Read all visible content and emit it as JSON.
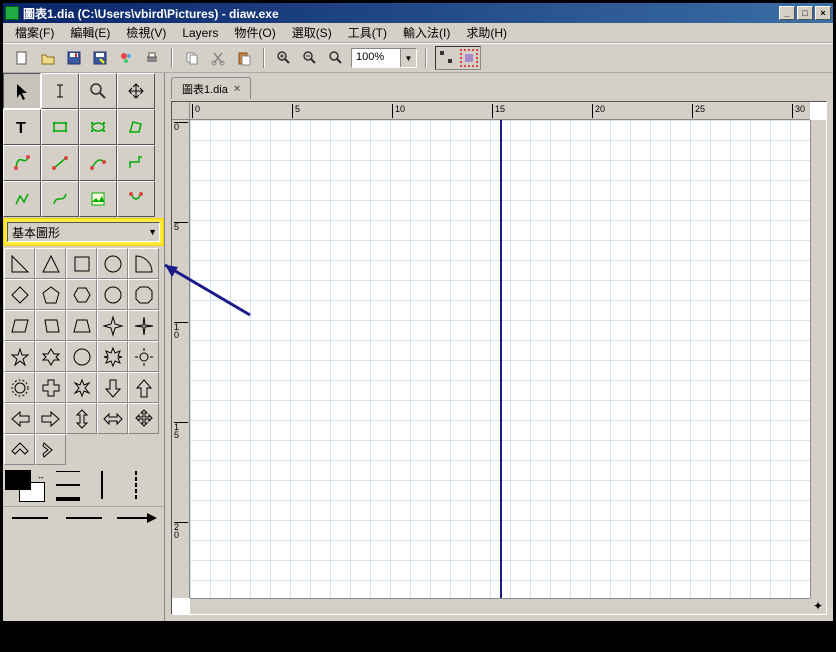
{
  "window": {
    "title": "圖表1.dia (C:\\Users\\vbird\\Pictures) - diaw.exe",
    "controls": {
      "min": "_",
      "max": "□",
      "close": "×"
    }
  },
  "menu": {
    "file": "檔案(F)",
    "edit": "編輯(E)",
    "view": "檢視(V)",
    "layers": "Layers",
    "objects": "物件(O)",
    "select": "選取(S)",
    "tools": "工具(T)",
    "input": "輸入法(I)",
    "help": "求助(H)"
  },
  "toolbar": {
    "zoom_value": "100%"
  },
  "tab": {
    "label": "圖表1.dia",
    "close": "×"
  },
  "shape_selector": {
    "label": "基本圖形"
  },
  "ruler": {
    "h": [
      "0",
      "5",
      "10",
      "15",
      "20",
      "25",
      "30"
    ],
    "v": [
      "0",
      "5",
      "10",
      "15",
      "20"
    ]
  }
}
